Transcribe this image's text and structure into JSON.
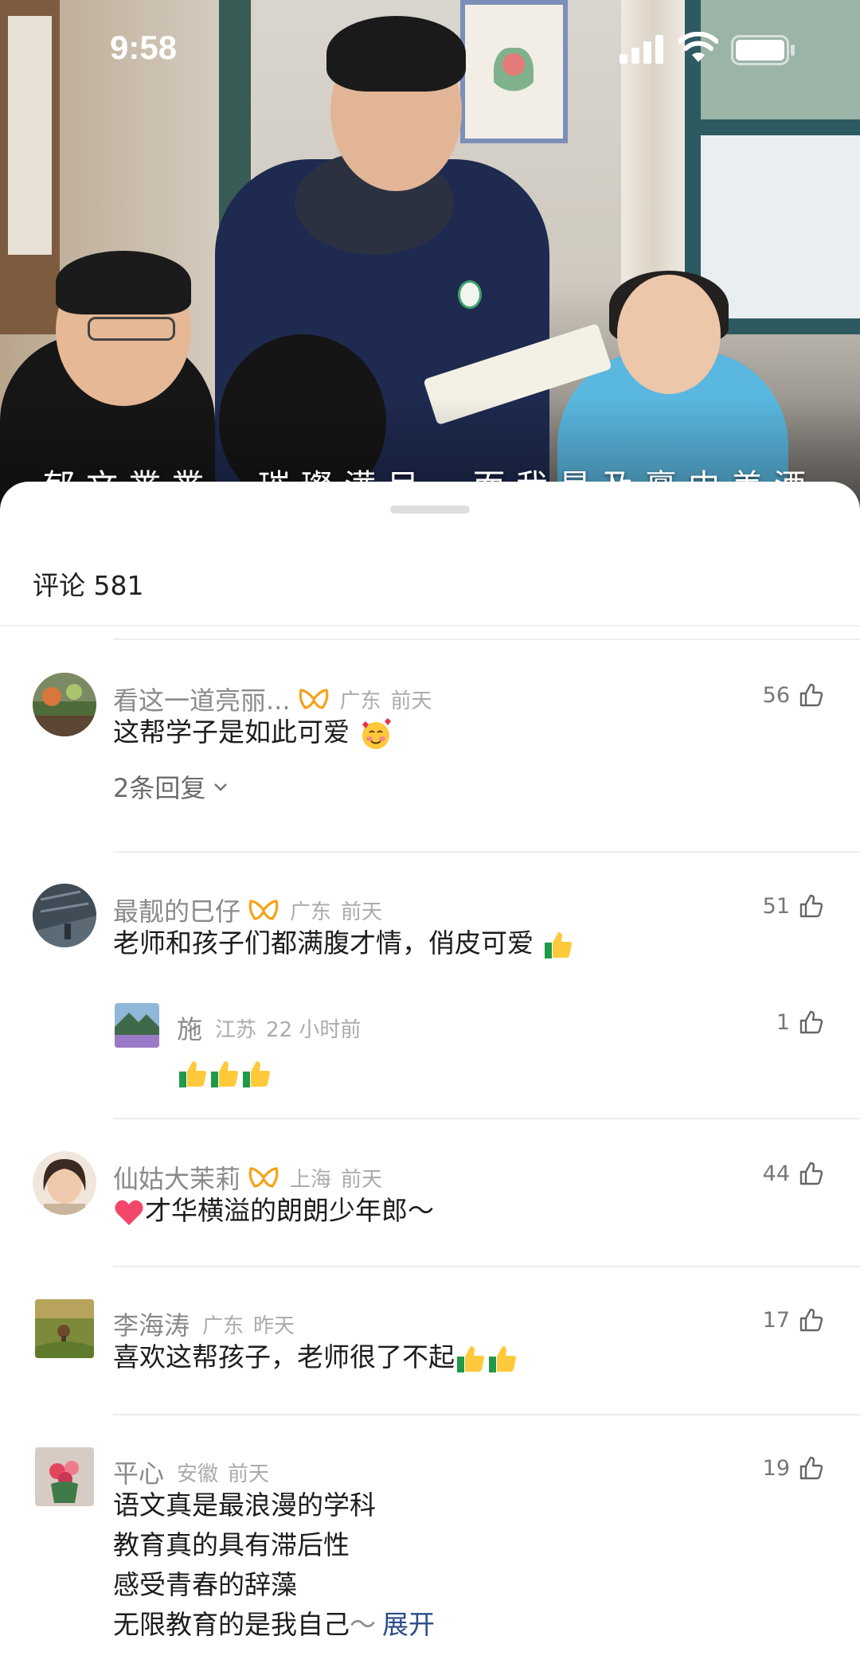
{
  "status_bar": {
    "time": "9:58"
  },
  "video": {
    "subtitle": "郁文黹黹，璀璨满目，而我是及禀中美酒"
  },
  "comments_header": {
    "label": "评论 581"
  },
  "comments": [
    {
      "name": "看这一道亮丽...",
      "location": "广东",
      "time": "前天",
      "text": "这帮学子是如此可爱",
      "likes": "56",
      "replies_label": "2条回复",
      "vip": true
    },
    {
      "name": "最靓的巳仔",
      "location": "广东",
      "time": "前天",
      "text": "老师和孩子们都满腹才情，俏皮可爱",
      "likes": "51",
      "vip": true,
      "reply": {
        "name": "施",
        "location": "江苏",
        "time": "22 小时前",
        "likes": "1"
      }
    },
    {
      "name": "仙姑大茉莉",
      "location": "上海",
      "time": "前天",
      "text": "才华横溢的朗朗少年郎～",
      "likes": "44",
      "vip": true
    },
    {
      "name": "李海涛",
      "location": "广东",
      "time": "昨天",
      "text": "喜欢这帮孩子，老师很了不起",
      "likes": "17",
      "vip": false
    },
    {
      "name": "平心",
      "location": "安徽",
      "time": "前天",
      "lines": [
        "语文真是最浪漫的学科",
        "教育真的具有滞后性",
        "感受青春的辞藻",
        "无限教育的是我自己"
      ],
      "tilde": "～",
      "expand_label": "展开",
      "likes": "19",
      "vip": false
    }
  ],
  "colors": {
    "vip_orange": "#f5a21a",
    "link_blue": "#2c4d89",
    "meta_gray": "#ababab"
  }
}
